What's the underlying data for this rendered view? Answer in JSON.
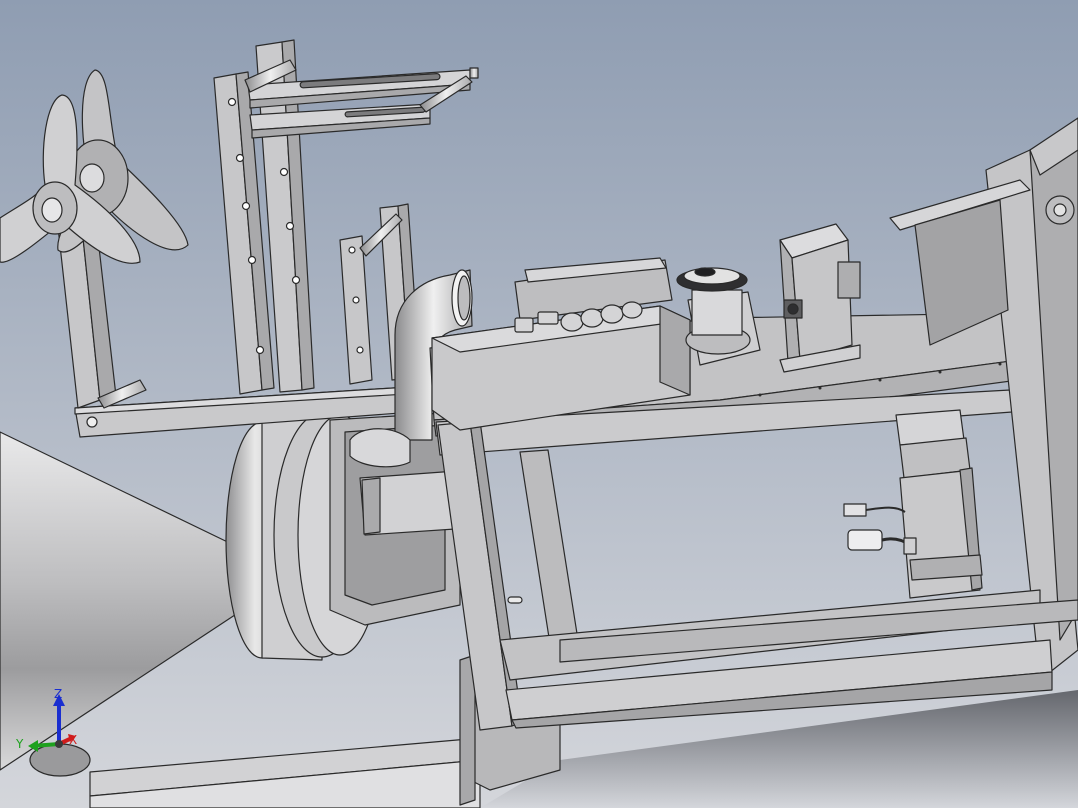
{
  "viewport": {
    "background_top": "#8f9db2",
    "background_bottom": "#d4d6db",
    "part_color": "#c6c6c8",
    "edge_color": "#2a2a2a"
  },
  "triad": {
    "x_label": "X",
    "y_label": "Y",
    "z_label": "Z",
    "x_color": "#d01c1c",
    "y_color": "#1ea11e",
    "z_color": "#1a2ed0"
  }
}
